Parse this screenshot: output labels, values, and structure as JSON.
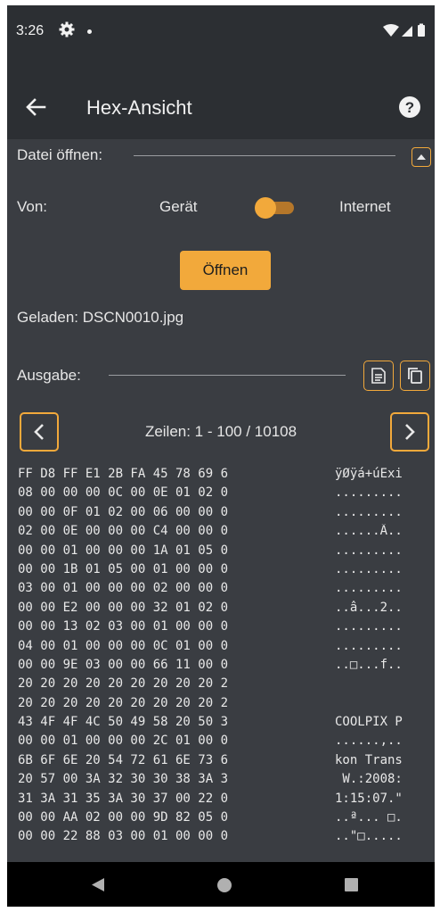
{
  "status": {
    "time": "3:26",
    "icons": [
      "gear-icon",
      "notification-dot",
      "wifi-icon",
      "signal-icon",
      "battery-icon"
    ]
  },
  "appbar": {
    "title": "Hex-Ansicht",
    "back_icon": "arrow-back-icon",
    "help_icon": "help-circle-icon"
  },
  "open_section": {
    "label": "Datei öffnen:",
    "collapse_icon": "chevron-up-icon",
    "source_label": "Von:",
    "option_device": "Gerät",
    "option_internet": "Internet",
    "toggle_state": "Gerät",
    "open_button": "Öffnen",
    "loaded_text": "Geladen: DSCN0010.jpg"
  },
  "output_section": {
    "label": "Ausgabe:",
    "text_icon": "document-text-icon",
    "copy_icon": "copy-icon",
    "lines_label": "Zeilen: 1 - 100 / 10108"
  },
  "hex_rows": [
    {
      "bytes": "FF D8 FF E1 2B FA 45 78 69 6",
      "ascii": "ÿØÿá+úExi"
    },
    {
      "bytes": "08 00 00 00 0C 00 0E 01 02 0",
      "ascii": "........."
    },
    {
      "bytes": "00 00 0F 01 02 00 06 00 00 0",
      "ascii": "........."
    },
    {
      "bytes": "02 00 0E 00 00 00 C4 00 00 0",
      "ascii": "......Ä.."
    },
    {
      "bytes": "00 00 01 00 00 00 1A 01 05 0",
      "ascii": "........."
    },
    {
      "bytes": "00 00 1B 01 05 00 01 00 00 0",
      "ascii": "........."
    },
    {
      "bytes": "03 00 01 00 00 00 02 00 00 0",
      "ascii": "........."
    },
    {
      "bytes": "00 00 E2 00 00 00 32 01 02 0",
      "ascii": "..â...2.."
    },
    {
      "bytes": "00 00 13 02 03 00 01 00 00 0",
      "ascii": "........."
    },
    {
      "bytes": "04 00 01 00 00 00 0C 01 00 0",
      "ascii": "........."
    },
    {
      "bytes": "00 00 9E 03 00 00 66 11 00 0",
      "ascii": "..□...f.."
    },
    {
      "bytes": "20 20 20 20 20 20 20 20 20 2",
      "ascii": ""
    },
    {
      "bytes": "20 20 20 20 20 20 20 20 20 2",
      "ascii": ""
    },
    {
      "bytes": "43 4F 4F 4C 50 49 58 20 50 3",
      "ascii": "COOLPIX P"
    },
    {
      "bytes": "00 00 01 00 00 00 2C 01 00 0",
      "ascii": "......,.."
    },
    {
      "bytes": "6B 6F 6E 20 54 72 61 6E 73 6",
      "ascii": "kon Trans"
    },
    {
      "bytes": "20 57 00 3A 32 30 30 38 3A 3",
      "ascii": " W.:2008:"
    },
    {
      "bytes": "31 3A 31 35 3A 30 37 00 22 0",
      "ascii": "1:15:07.\""
    },
    {
      "bytes": "00 00 AA 02 00 00 9D 82 05 0",
      "ascii": "..ª... □."
    },
    {
      "bytes": "00 00 22 88 03 00 01 00 00 0",
      "ascii": "..\"□....."
    }
  ],
  "navbar": {
    "back": "triangle-back-icon",
    "home": "circle-home-icon",
    "recent": "square-recent-icon"
  }
}
